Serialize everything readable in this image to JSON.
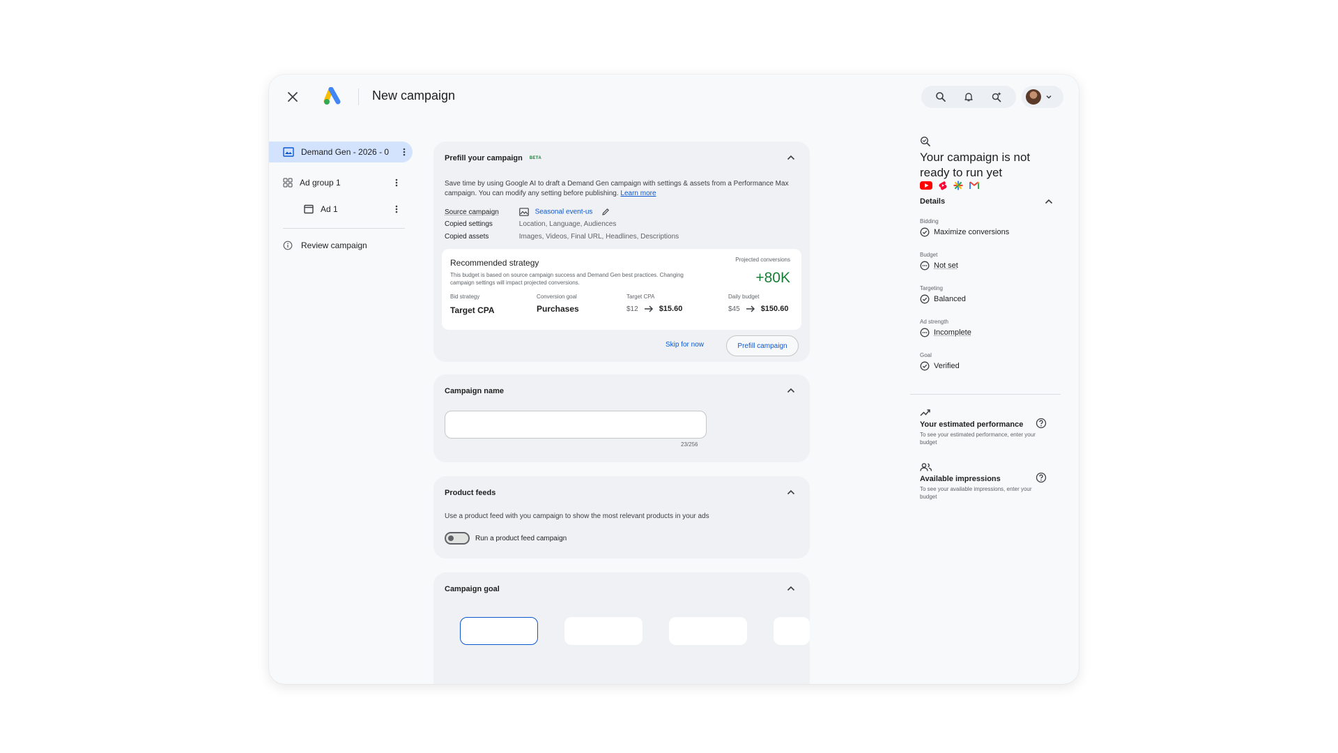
{
  "header": {
    "title": "New campaign"
  },
  "leftnav": {
    "campaign": "Demand Gen - 2026 - 0",
    "ad_group": "Ad group 1",
    "ad": "Ad 1",
    "review": "Review campaign"
  },
  "prefill": {
    "title": "Prefill your campaign",
    "beta": "BETA",
    "description": "Save time by using Google AI to draft a Demand Gen campaign with settings & assets from a Performance Max campaign. You can modify any setting before publishing.",
    "learn_more": "Learn more",
    "source_label": "Source campaign",
    "source_value": "Seasonal event-us",
    "copied_settings_label": "Copied settings",
    "copied_settings_value": "Location, Language, Audiences",
    "copied_assets_label": "Copied assets",
    "copied_assets_value": "Images, Videos, Final URL, Headlines, Descriptions",
    "strategy": {
      "title": "Recommended strategy",
      "description": "This budget is based on source campaign success and Demand Gen best practices. Changing campaign settings will impact projected conversions.",
      "projected_label": "Projected conversions",
      "projected_value": "+80K",
      "bid_strategy_label": "Bid strategy",
      "bid_strategy_value": "Target CPA",
      "conversion_goal_label": "Conversion goal",
      "conversion_goal_value": "Purchases",
      "target_cpa_label": "Target CPA",
      "target_cpa_old": "$12",
      "target_cpa_new": "$15.60",
      "daily_budget_label": "Daily budget",
      "daily_budget_old": "$45",
      "daily_budget_new": "$150.60"
    },
    "skip_label": "Skip for now",
    "prefill_button": "Prefill campaign"
  },
  "campaign_name": {
    "title": "Campaign name",
    "value": "",
    "char_count": "23/256"
  },
  "product_feeds": {
    "title": "Product feeds",
    "description": "Use a product feed with you campaign to show the most relevant products in your ads",
    "toggle_label": "Run a product feed campaign",
    "toggle_on": false
  },
  "campaign_goal": {
    "title": "Campaign goal"
  },
  "status_panel": {
    "title": "Your campaign is not ready to run yet",
    "details_label": "Details",
    "details": [
      {
        "label": "Bidding",
        "value": "Maximize conversions",
        "status": "complete"
      },
      {
        "label": "Budget",
        "value": "Not set",
        "status": "pending"
      },
      {
        "label": "Targeting",
        "value": "Balanced",
        "status": "complete"
      },
      {
        "label": "Ad strength",
        "value": "Incomplete",
        "status": "pending"
      },
      {
        "label": "Goal",
        "value": "Verified",
        "status": "complete"
      }
    ],
    "performance": {
      "title": "Your estimated performance",
      "description": "To see your estimated performance, enter your budget"
    },
    "impressions": {
      "title": "Available impressions",
      "description": "To see your available impressions, enter your budget"
    }
  },
  "colors": {
    "accent": "#0b57d0",
    "positive": "#188038",
    "nav_selected": "#d3e3fd"
  }
}
